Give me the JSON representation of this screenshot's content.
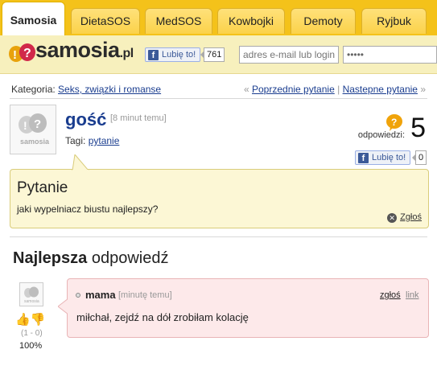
{
  "tabs": [
    {
      "label": "Samosia",
      "active": true
    },
    {
      "label": "DietaSOS",
      "active": false
    },
    {
      "label": "MedSOS",
      "active": false
    },
    {
      "label": "Kowbojki",
      "active": false
    },
    {
      "label": "Demoty",
      "active": false
    },
    {
      "label": "Ryjbuk",
      "active": false
    }
  ],
  "header": {
    "logo_text": "samosia",
    "logo_tld": ".pl",
    "like_label": "Lubię to!",
    "like_count": "761",
    "email_placeholder": "adres e-mail lub login",
    "password_value": "●●●●●"
  },
  "breadcrumb": {
    "category_prefix": "Kategoria:",
    "category_link": "Seks, związki i romanse",
    "prev_arrow": "«",
    "prev_label": "Poprzednie pytanie",
    "separator": "|",
    "next_label": "Nastepne pytanie",
    "next_arrow": "»"
  },
  "question": {
    "author": "gość",
    "time": "[8 minut temu]",
    "tags_label": "Tagi:",
    "tag": "pytanie",
    "answers_label": "odpowiedzi:",
    "answers_count": "5",
    "like_label": "Lubię to!",
    "like_count": "0",
    "title": "Pytanie",
    "text": "jaki wypelniacz biustu najlepszy?",
    "report_label": "Zgłoś"
  },
  "best_answer": {
    "heading_bold": "Najlepsza",
    "heading_rest": " odpowiedź",
    "author": "mama",
    "time": "[minutę temu]",
    "report_label": "zgłoś",
    "link_label": "link",
    "text": "miłchał, zejdź na dół zrobiłam kolację",
    "votes": "(1 - 0)",
    "percent": "100%"
  },
  "colors": {
    "brand_yellow": "#f4c21a",
    "link_blue": "#1a3d8f",
    "question_bg": "#fcf7d5",
    "answer_bg": "#fde9ea"
  }
}
